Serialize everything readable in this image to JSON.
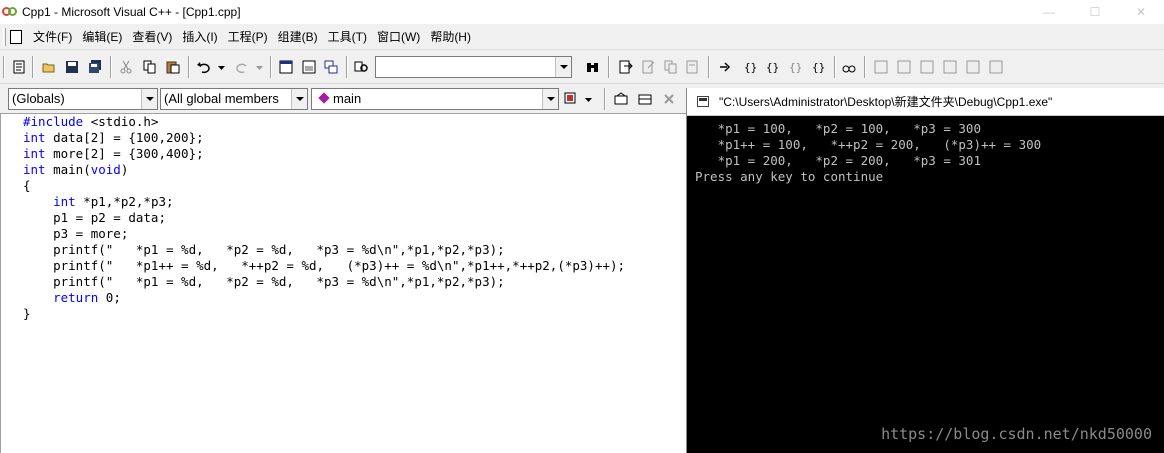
{
  "window": {
    "title": "Cpp1 - Microsoft Visual C++ - [Cpp1.cpp]",
    "controls": [
      "—",
      "☐",
      "✕"
    ]
  },
  "menu": {
    "items": [
      "文件(F)",
      "编辑(E)",
      "查看(V)",
      "插入(I)",
      "工程(P)",
      "组建(B)",
      "工具(T)",
      "窗口(W)",
      "帮助(H)"
    ]
  },
  "toolbar": {
    "find_value": ""
  },
  "wizardbar": {
    "scope": "(Globals)",
    "members": "(All global members",
    "function": "main"
  },
  "editor": {
    "lines": [
      "#include <stdio.h>",
      "int data[2] = {100,200};",
      "int more[2] = {300,400};",
      "int main(void)",
      "{",
      "    int *p1,*p2,*p3;",
      "    p1 = p2 = data;",
      "    p3 = more;",
      "    printf(\"   *p1 = %d,   *p2 = %d,   *p3 = %d\\n\",*p1,*p2,*p3);",
      "    printf(\"   *p1++ = %d,   *++p2 = %d,   (*p3)++ = %d\\n\",*p1++,*++p2,(*p3)++);",
      "    printf(\"   *p1 = %d,   *p2 = %d,   *p3 = %d\\n\",*p1,*p2,*p3);",
      "    return 0;",
      "}"
    ]
  },
  "console": {
    "title": "\"C:\\Users\\Administrator\\Desktop\\新建文件夹\\Debug\\Cpp1.exe\"",
    "lines": [
      "   *p1 = 100,   *p2 = 100,   *p3 = 300",
      "   *p1++ = 100,   *++p2 = 200,   (*p3)++ = 300",
      "   *p1 = 200,   *p2 = 200,   *p3 = 301",
      "Press any key to continue"
    ],
    "watermark": "https://blog.csdn.net/nkd50000"
  },
  "colors": {
    "keyword": "#0000ff",
    "console_bg": "#000000",
    "console_text": "#c0c0c0"
  }
}
